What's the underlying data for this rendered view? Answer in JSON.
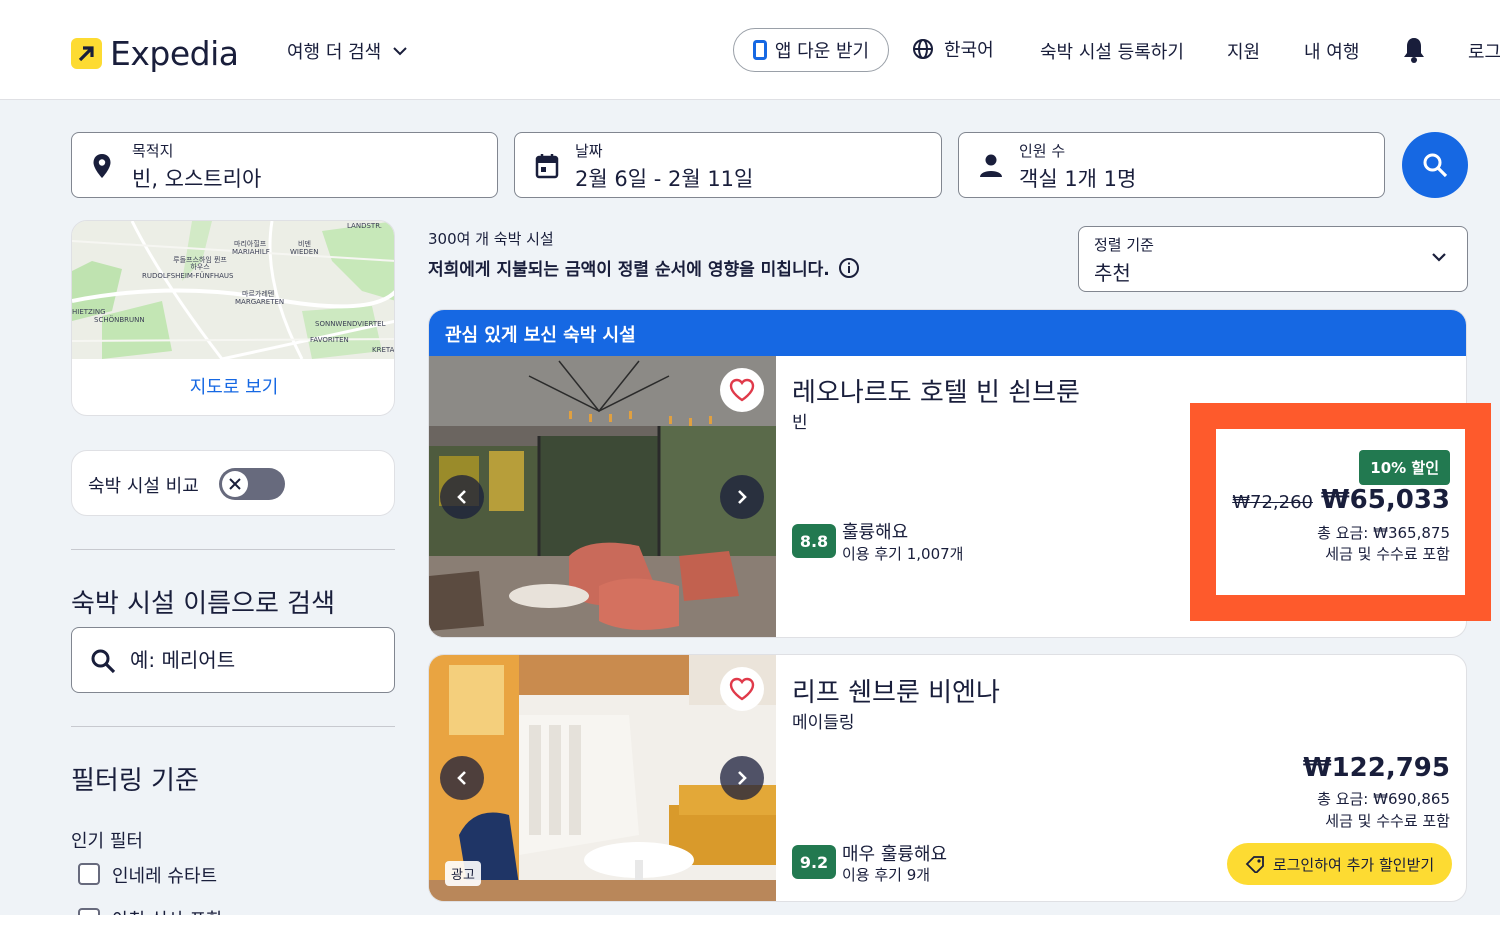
{
  "header": {
    "logo_text": "Expedia",
    "more_travel": "여행 더 검색",
    "app_download": "앱 다운 받기",
    "language": "한국어",
    "list_property": "숙박 시설 등록하기",
    "support": "지원",
    "my_trips": "내 여행",
    "login": "로그"
  },
  "search": {
    "destination_label": "목적지",
    "destination_value": "빈, 오스트리아",
    "dates_label": "날짜",
    "dates_value": "2월 6일 - 2월 11일",
    "guests_label": "인원 수",
    "guests_value": "객실 1개 1명"
  },
  "sidebar": {
    "map_link": "지도로 보기",
    "map_labels": [
      "LANDSTR.",
      "마리아힐프",
      "MARIAHILF",
      "비덴",
      "WIEDEN",
      "루돌프스하임 퓐프하우스",
      "RUDOLFSHEIM-FÜNFHAUS",
      "마르가레텐",
      "MARGARETEN",
      "SONNWENDVIERTEL",
      "FAVORITEN",
      "SCHÖNBRUNN",
      "HIETZING",
      "KRETA"
    ],
    "compare_label": "숙박 시설 비교",
    "name_search_heading": "숙박 시설 이름으로 검색",
    "name_search_placeholder": "예: 메리어트",
    "filter_heading": "필터링 기준",
    "popular_filters_label": "인기 필터",
    "filters": [
      "인네레 슈타트",
      "아침 식사 포함"
    ]
  },
  "results": {
    "count": "300여 개 숙박 시설",
    "notice": "저희에게 지불되는 금액이 정렬 순서에 영향을 미칩니다.",
    "sort_label": "정렬 기준",
    "sort_value": "추천"
  },
  "hotels": [
    {
      "banner": "관심 있게 보신 숙박 시설",
      "name": "레오나르도 호텔 빈 쇤브룬",
      "location": "빈",
      "score": "8.8",
      "rating_word": "훌륭해요",
      "reviews": "이용 후기 1,007개",
      "discount": "10% 할인",
      "old_price": "₩72,260",
      "price": "₩65,033",
      "total": "총 요금: ₩365,875",
      "taxes": "세금 및 수수료 포함"
    },
    {
      "name": "리프 쉔브룬 비엔나",
      "location": "메이들링",
      "ad_label": "광고",
      "score": "9.2",
      "rating_word": "매우 훌륭해요",
      "reviews": "이용 후기 9개",
      "price": "₩122,795",
      "total": "총 요금: ₩690,865",
      "taxes": "세금 및 수수료 포함",
      "login_deal": "로그인하여 추가 할인받기"
    }
  ],
  "colors": {
    "brand_blue": "#1668e3",
    "brand_yellow": "#fddb32",
    "score_green": "#227950",
    "highlight_orange": "#fe5a2c"
  }
}
